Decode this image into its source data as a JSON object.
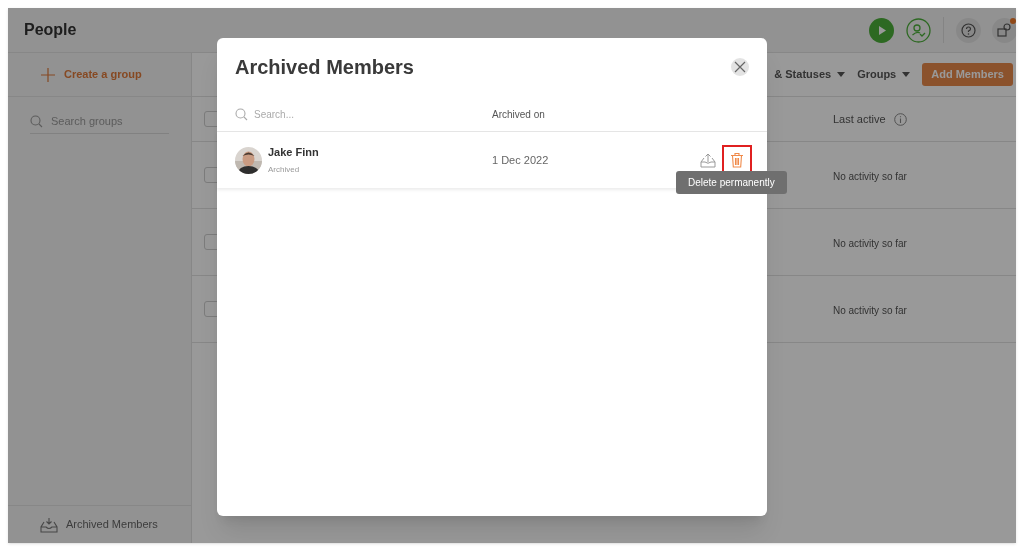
{
  "header": {
    "title": "People",
    "notification": true
  },
  "sidebar": {
    "create_label": "Create a group",
    "search_placeholder": "Search groups",
    "footer_label": "Archived Members"
  },
  "toolbar": {
    "filters": [
      {
        "label": "& Statuses"
      },
      {
        "label": "Groups"
      }
    ],
    "primary_button": "Add Members"
  },
  "table": {
    "columns": [
      {
        "label": "Last active"
      }
    ],
    "select_all_checked": false,
    "rows": [
      {
        "checked": false,
        "last_active": "No activity so far"
      },
      {
        "checked": false,
        "last_active": "No activity so far"
      },
      {
        "checked": false,
        "last_active": "No activity so far"
      }
    ]
  },
  "modal": {
    "title": "Archived Members",
    "search_placeholder": "Search...",
    "column": "Archived on",
    "members": [
      {
        "name": "Jake Finn",
        "status": "Archived",
        "archived_on": "1 Dec 2022",
        "delete_highlighted": true
      }
    ],
    "tooltip": "Delete permanently"
  }
}
